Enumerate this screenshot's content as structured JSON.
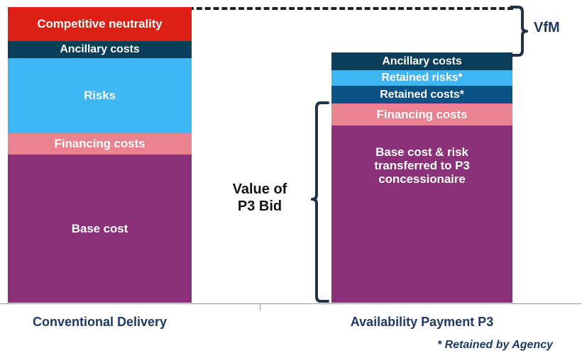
{
  "chart_data": {
    "type": "bar",
    "title": "",
    "subtitle": "",
    "xlabel": "",
    "ylabel": "",
    "stacked": true,
    "grid": false,
    "legend_position": "none",
    "annotations": {
      "vfm_label": "VfM",
      "p3_bid_label_line1": "Value of",
      "p3_bid_label_line2": "P3 Bid",
      "footnote": "* Retained by Agency",
      "dashed_connector": "top of Conventional Delivery stack extended to P3 column"
    },
    "categories": [
      "Conventional Delivery",
      "Availability Payment P3"
    ],
    "series": [
      {
        "name": "Conventional Delivery",
        "segments": [
          {
            "label": "Competitive neutrality",
            "value": 48,
            "color": "#DC2016"
          },
          {
            "label": "Ancillary costs",
            "value": 24,
            "color": "#0A3E5A"
          },
          {
            "label": "Risks",
            "value": 106,
            "color": "#3FB7F2"
          },
          {
            "label": "Financing costs",
            "value": 30,
            "color": "#E8838F"
          },
          {
            "label": "Base cost",
            "value": 209,
            "color": "#8B3179"
          }
        ],
        "total": 417
      },
      {
        "name": "Availability Payment P3",
        "segments": [
          {
            "label": "Ancillary costs",
            "value": 25,
            "color": "#0A3E5A"
          },
          {
            "label": "Retained risks*",
            "value": 22,
            "color": "#3FB7F2"
          },
          {
            "label": "Retained costs*",
            "value": 25,
            "color": "#0B5384"
          },
          {
            "label": "Financing costs",
            "value": 31,
            "color": "#E8838F"
          },
          {
            "label": "Base cost & risk transferred to P3 concessionaire",
            "value": 250,
            "color": "#8B3179"
          }
        ],
        "total": 353
      }
    ]
  },
  "axis": {
    "tick_label": ""
  },
  "colors": {
    "competitive_neutrality": "#DC2016",
    "ancillary_costs": "#0A3E5A",
    "risks": "#3FB7F2",
    "retained_costs": "#0B5384",
    "financing_costs": "#E8838F",
    "base_cost": "#8B3179",
    "label_text": "#1f3864",
    "bracket": "#1f3247",
    "axis": "#9a9a9a"
  }
}
